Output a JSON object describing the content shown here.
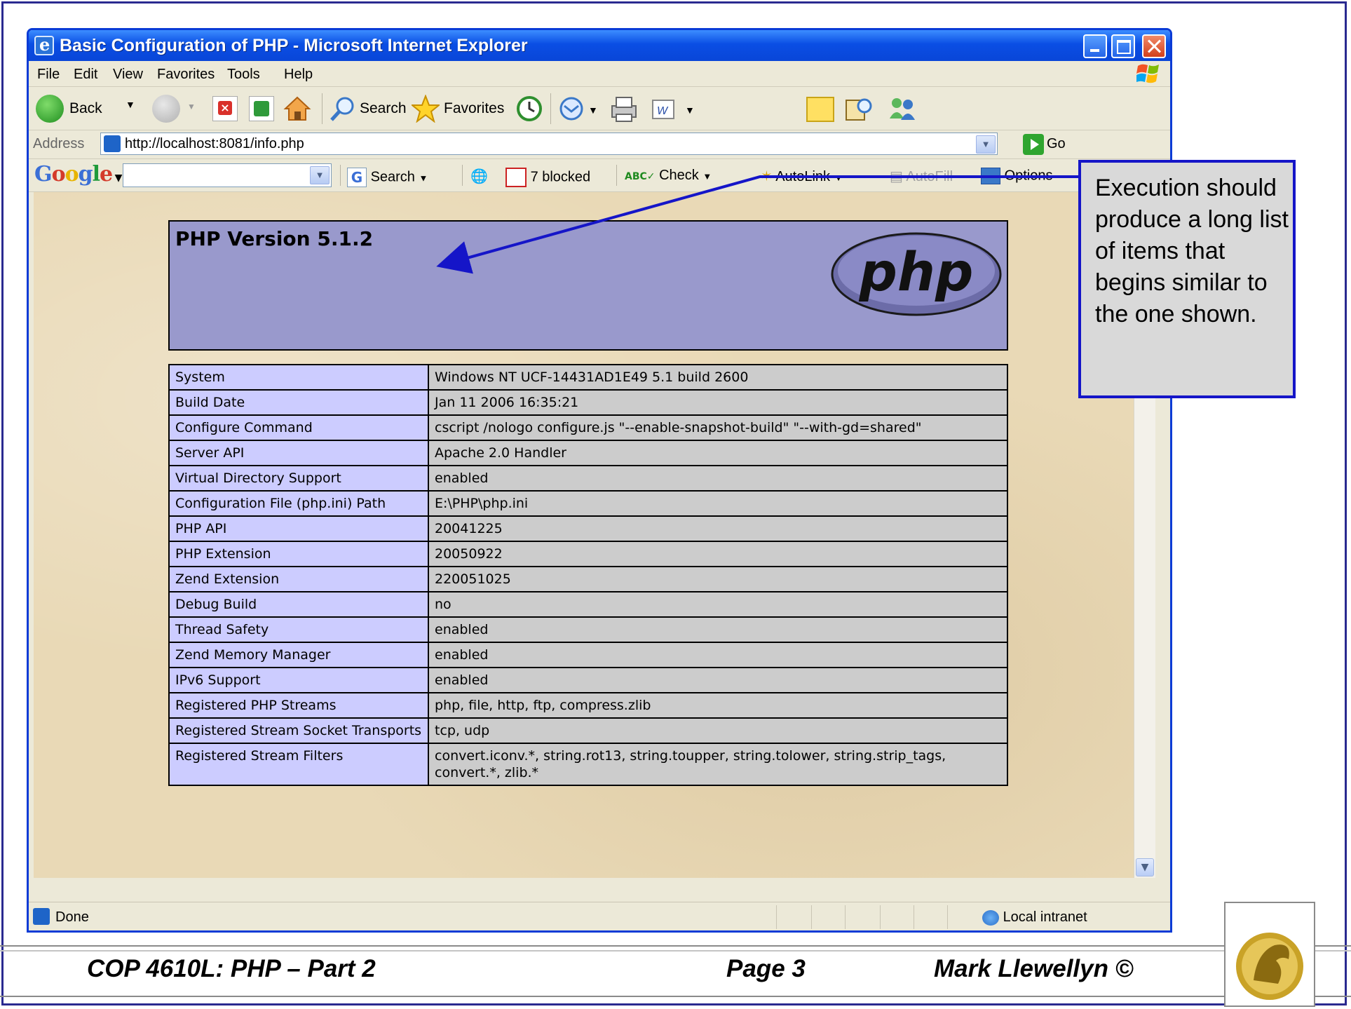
{
  "window": {
    "title": "Basic Configuration of PHP - Microsoft Internet Explorer"
  },
  "menu": [
    "File",
    "Edit",
    "View",
    "Favorites",
    "Tools",
    "Help"
  ],
  "toolbar": {
    "back_label": "Back",
    "search_label": "Search",
    "favorites_label": "Favorites"
  },
  "address": {
    "label": "Address",
    "url": "http://localhost:8081/info.php",
    "go_label": "Go"
  },
  "google_bar": {
    "logo": "Google",
    "search_label": "Search",
    "blocked_label": "7 blocked",
    "check_label": "Check",
    "autolink_label": "AutoLink",
    "autofill_label": "AutoFill",
    "options_label": "Options"
  },
  "php": {
    "version": "PHP Version 5.1.2",
    "logo_text": "php"
  },
  "info_rows": [
    {
      "key": "System",
      "value": "Windows NT UCF-14431AD1E49 5.1 build 2600"
    },
    {
      "key": "Build Date",
      "value": "Jan 11 2006 16:35:21"
    },
    {
      "key": "Configure Command",
      "value": "cscript /nologo configure.js \"--enable-snapshot-build\" \"--with-gd=shared\""
    },
    {
      "key": "Server API",
      "value": "Apache 2.0 Handler"
    },
    {
      "key": "Virtual Directory Support",
      "value": "enabled"
    },
    {
      "key": "Configuration File (php.ini) Path",
      "value": "E:\\PHP\\php.ini"
    },
    {
      "key": "PHP API",
      "value": "20041225"
    },
    {
      "key": "PHP Extension",
      "value": "20050922"
    },
    {
      "key": "Zend Extension",
      "value": "220051025"
    },
    {
      "key": "Debug Build",
      "value": "no"
    },
    {
      "key": "Thread Safety",
      "value": "enabled"
    },
    {
      "key": "Zend Memory Manager",
      "value": "enabled"
    },
    {
      "key": "IPv6 Support",
      "value": "enabled"
    },
    {
      "key": "Registered PHP Streams",
      "value": "php, file, http, ftp, compress.zlib"
    },
    {
      "key": "Registered Stream Socket Transports",
      "value": "tcp, udp"
    },
    {
      "key": "Registered Stream Filters",
      "value": "convert.iconv.*, string.rot13, string.toupper, string.tolower, string.strip_tags, convert.*, zlib.*"
    }
  ],
  "status": {
    "text": "Done",
    "zone": "Local intranet"
  },
  "callout": {
    "text": "Execution should produce a long list of items that begins similar to the one shown."
  },
  "footer": {
    "course": "COP 4610L: PHP – Part 2",
    "page": "Page 3",
    "author": "Mark Llewellyn ©"
  },
  "colors": {
    "php_header": "#9999cc",
    "key_cell": "#ccccff",
    "value_cell": "#cccccc",
    "callout_border": "#1515c8",
    "title_bar": "#0a4ee4"
  }
}
